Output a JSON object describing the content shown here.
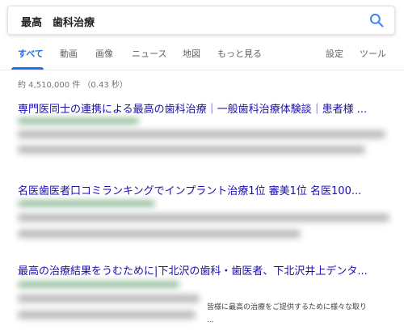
{
  "search": {
    "query": "最高　歯科治療"
  },
  "tabs": {
    "all": "すべて",
    "videos": "動画",
    "images": "画像",
    "news": "ニュース",
    "maps": "地図",
    "more": "もっと見る",
    "settings": "設定",
    "tools": "ツール"
  },
  "stats": "約 4,510,000 件 （0.43 秒）",
  "results": [
    {
      "title": "専門医同士の連携による最高の歯科治療｜一般歯科治療体験談｜患者様 ..."
    },
    {
      "title": "名医歯医者口コミランキングでインプラント治療1位 審美1位 名医100..."
    },
    {
      "title": "最高の治療結果をうむために|下北沢の歯科・歯医者、下北沢井上デンタ..."
    }
  ],
  "snippet": {
    "line1": "皆様に最高の治療をご提供するために様々な取り",
    "line2": "..."
  },
  "colors": {
    "accent": "#1a73e8",
    "link": "#1a0dab",
    "muted": "#5f6368"
  },
  "icons": {
    "search": "search-icon"
  }
}
